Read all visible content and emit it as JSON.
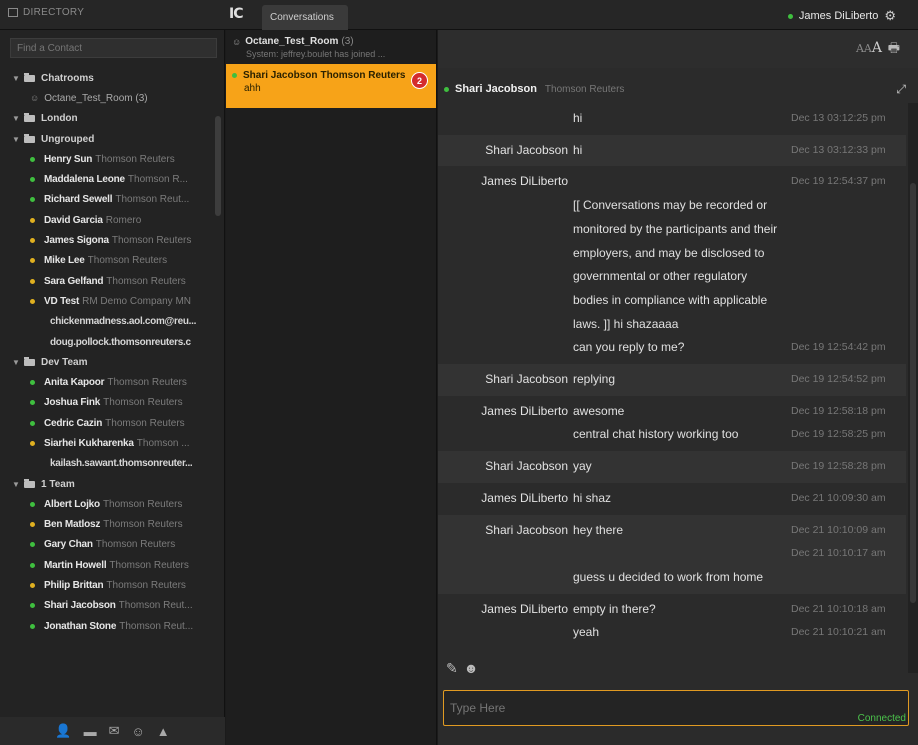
{
  "header": {
    "directory_label": "DIRECTORY",
    "logo": "IC",
    "conversations_tab": "Conversations",
    "user_name": "James DiLiberto",
    "accent_color": "#f7a318"
  },
  "directory": {
    "search_placeholder": "Find a Contact",
    "rows": [
      {
        "kind": "group",
        "label": "Chatrooms"
      },
      {
        "kind": "room",
        "label": "Octane_Test_Room (3)"
      },
      {
        "kind": "group",
        "label": "London"
      },
      {
        "kind": "group",
        "label": "Ungrouped"
      },
      {
        "kind": "contact",
        "name": "Henry Sun",
        "org": "Thomson Reuters",
        "status": "green"
      },
      {
        "kind": "contact",
        "name": "Maddalena Leone",
        "org": "Thomson R...",
        "status": "green"
      },
      {
        "kind": "contact",
        "name": "Richard Sewell",
        "org": "Thomson Reut...",
        "status": "green"
      },
      {
        "kind": "contact",
        "name": "David Garcia",
        "org": "Romero",
        "status": "yellow"
      },
      {
        "kind": "contact",
        "name": "James Sigona",
        "org": "Thomson Reuters",
        "status": "yellow"
      },
      {
        "kind": "contact",
        "name": "Mike Lee",
        "org": "Thomson Reuters",
        "status": "yellow"
      },
      {
        "kind": "contact",
        "name": "Sara Gelfand",
        "org": "Thomson Reuters",
        "status": "yellow"
      },
      {
        "kind": "contact",
        "name": "VD Test",
        "org": "RM Demo Company MN",
        "status": "yellow"
      },
      {
        "kind": "email",
        "label": "chickenmadness.aol.com@reu..."
      },
      {
        "kind": "email",
        "label": "doug.pollock.thomsonreuters.c"
      },
      {
        "kind": "group",
        "label": "Dev Team"
      },
      {
        "kind": "contact",
        "name": "Anita Kapoor",
        "org": "Thomson Reuters",
        "status": "green"
      },
      {
        "kind": "contact",
        "name": "Joshua Fink",
        "org": "Thomson Reuters",
        "status": "green"
      },
      {
        "kind": "contact",
        "name": "Cedric Cazin",
        "org": "Thomson Reuters",
        "status": "green"
      },
      {
        "kind": "contact",
        "name": "Siarhei Kukharenka",
        "org": "Thomson ...",
        "status": "yellow"
      },
      {
        "kind": "email",
        "label": "kailash.sawant.thomsonreuter..."
      },
      {
        "kind": "group",
        "label": "1 Team"
      },
      {
        "kind": "contact",
        "name": "Albert Lojko",
        "org": "Thomson Reuters",
        "status": "green"
      },
      {
        "kind": "contact",
        "name": "Ben Matlosz",
        "org": "Thomson Reuters",
        "status": "yellow"
      },
      {
        "kind": "contact",
        "name": "Gary Chan",
        "org": "Thomson Reuters",
        "status": "green"
      },
      {
        "kind": "contact",
        "name": "Martin Howell",
        "org": "Thomson Reuters",
        "status": "green"
      },
      {
        "kind": "contact",
        "name": "Philip Brittan",
        "org": "Thomson Reuters",
        "status": "yellow"
      },
      {
        "kind": "contact",
        "name": "Shari Jacobson",
        "org": "Thomson Reut...",
        "status": "green"
      },
      {
        "kind": "contact",
        "name": "Jonathan Stone",
        "org": "Thomson Reut...",
        "status": "green"
      }
    ]
  },
  "conversations": [
    {
      "title": "Octane_Test_Room",
      "count": "(3)",
      "subtitle": "System: jeffrey.boulet has joined ...",
      "active": false
    },
    {
      "title": "Shari Jacobson",
      "org": "Thomson Reuters",
      "subtitle": "ahh",
      "badge": "2",
      "active": true
    }
  ],
  "chat": {
    "contact_name": "Shari Jacobson",
    "contact_org": "Thomson Reuters",
    "font_small": "AA",
    "font_large": "A",
    "messages": [
      {
        "who": "",
        "alt": false,
        "lines": [
          {
            "text": "hi",
            "time": "Dec 13 03:12:25 pm"
          }
        ]
      },
      {
        "who": "Shari Jacobson",
        "alt": true,
        "lines": [
          {
            "text": "hi",
            "time": "Dec 13 03:12:33 pm"
          }
        ]
      },
      {
        "who": "James DiLiberto",
        "alt": false,
        "lines": [
          {
            "text": "",
            "time": "Dec 19 12:54:37 pm"
          },
          {
            "text": "[[ Conversations may be recorded or",
            "time": ""
          },
          {
            "text": "monitored by the participants and their",
            "time": ""
          },
          {
            "text": "employers, and may be disclosed to",
            "time": ""
          },
          {
            "text": "governmental or other regulatory",
            "time": ""
          },
          {
            "text": "bodies in compliance with applicable",
            "time": ""
          },
          {
            "text": "laws. ]] hi shazaaaa",
            "time": ""
          },
          {
            "text": "can you reply to me?",
            "time": "Dec 19 12:54:42 pm"
          }
        ]
      },
      {
        "who": "Shari Jacobson",
        "alt": true,
        "lines": [
          {
            "text": "replying",
            "time": "Dec 19 12:54:52 pm"
          }
        ]
      },
      {
        "who": "James DiLiberto",
        "alt": false,
        "lines": [
          {
            "text": "awesome",
            "time": "Dec 19 12:58:18 pm"
          },
          {
            "text": "central chat history working too",
            "time": "Dec 19 12:58:25 pm"
          }
        ]
      },
      {
        "who": "Shari Jacobson",
        "alt": true,
        "lines": [
          {
            "text": "yay",
            "time": "Dec 19 12:58:28 pm"
          }
        ]
      },
      {
        "who": "James DiLiberto",
        "alt": false,
        "lines": [
          {
            "text": "hi shaz",
            "time": "Dec 21 10:09:30 am"
          }
        ]
      },
      {
        "who": "Shari Jacobson",
        "alt": true,
        "lines": [
          {
            "text": "hey there",
            "time": "Dec 21 10:10:09 am"
          },
          {
            "text": "",
            "time": "Dec 21 10:10:17 am"
          },
          {
            "text": "guess u decided to work from home",
            "time": ""
          }
        ]
      },
      {
        "who": "James DiLiberto",
        "alt": false,
        "lines": [
          {
            "text": "empty in there?",
            "time": "Dec 21 10:10:18 am"
          },
          {
            "text": "yeah",
            "time": "Dec 21 10:10:21 am"
          }
        ]
      }
    ],
    "input_placeholder": "Type Here",
    "connection_status": "Connected"
  }
}
